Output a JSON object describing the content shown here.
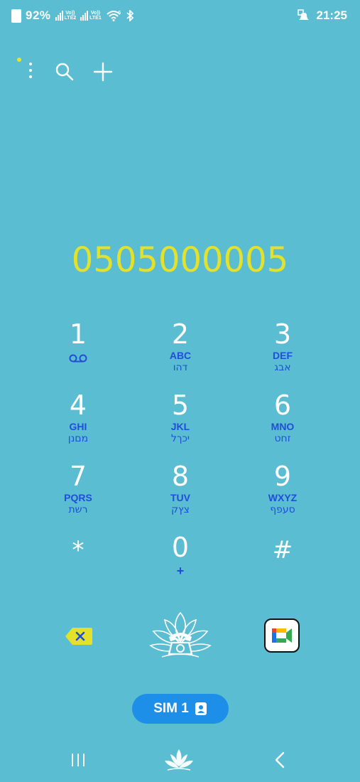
{
  "status_bar": {
    "battery": "92%",
    "sim2_label": "LTE2",
    "sim1_label": "LTE1",
    "volte_label": "Vo))",
    "wifi_badge": "6",
    "time": "21:25"
  },
  "toolbar": {
    "icons": [
      "more-options-icon",
      "search-icon",
      "add-icon"
    ]
  },
  "dialer": {
    "number": "0505000005",
    "keys": [
      {
        "digit": "1",
        "letters": "",
        "hebrew": ""
      },
      {
        "digit": "2",
        "letters": "ABC",
        "hebrew": "דהו"
      },
      {
        "digit": "3",
        "letters": "DEF",
        "hebrew": "אבג"
      },
      {
        "digit": "4",
        "letters": "GHI",
        "hebrew": "מםנן"
      },
      {
        "digit": "5",
        "letters": "JKL",
        "hebrew": "יכךל"
      },
      {
        "digit": "6",
        "letters": "MNO",
        "hebrew": "זחט"
      },
      {
        "digit": "7",
        "letters": "PQRS",
        "hebrew": "רשת"
      },
      {
        "digit": "8",
        "letters": "TUV",
        "hebrew": "צץק"
      },
      {
        "digit": "9",
        "letters": "WXYZ",
        "hebrew": "סעפף"
      },
      {
        "digit": "*",
        "letters": "",
        "hebrew": ""
      },
      {
        "digit": "0",
        "letters": "+",
        "hebrew": ""
      },
      {
        "digit": "#",
        "letters": "",
        "hebrew": ""
      }
    ]
  },
  "actions": {
    "sim_button_label": "SIM 1"
  },
  "colors": {
    "background": "#5bbdd2",
    "number_text": "#e4e12a",
    "key_letters": "#1f4fd6",
    "sim_button": "#1e8fe8",
    "backspace": "#e4e12a"
  }
}
